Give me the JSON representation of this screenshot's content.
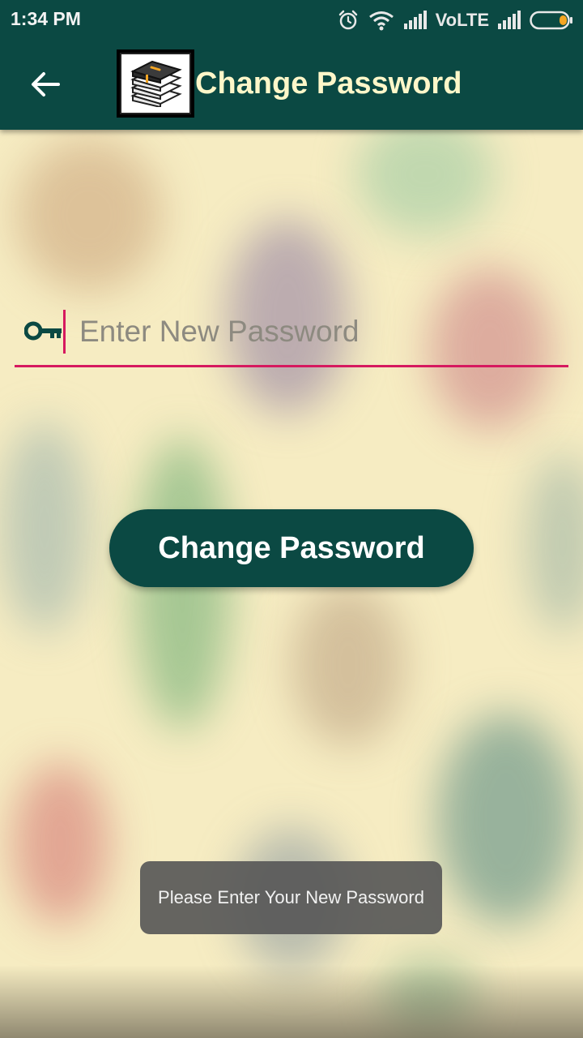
{
  "status_bar": {
    "time": "1:34 PM",
    "network_label": "VoLTE",
    "icons": [
      "alarm-icon",
      "wifi-icon",
      "signal-icon",
      "signal-icon",
      "battery-icon"
    ],
    "battery_color": "#f5a623"
  },
  "app_bar": {
    "title": "Change Password",
    "back_icon": "arrow-left-icon",
    "logo_icon": "books-logo-icon",
    "background_color": "#0b4943",
    "title_color": "#fff7c9"
  },
  "form": {
    "password_field": {
      "icon": "key-icon",
      "placeholder": "Enter New Password",
      "value": "",
      "accent_color": "#d6195f"
    },
    "submit_label": "Change Password"
  },
  "toast": {
    "message": "Please Enter Your New Password"
  }
}
